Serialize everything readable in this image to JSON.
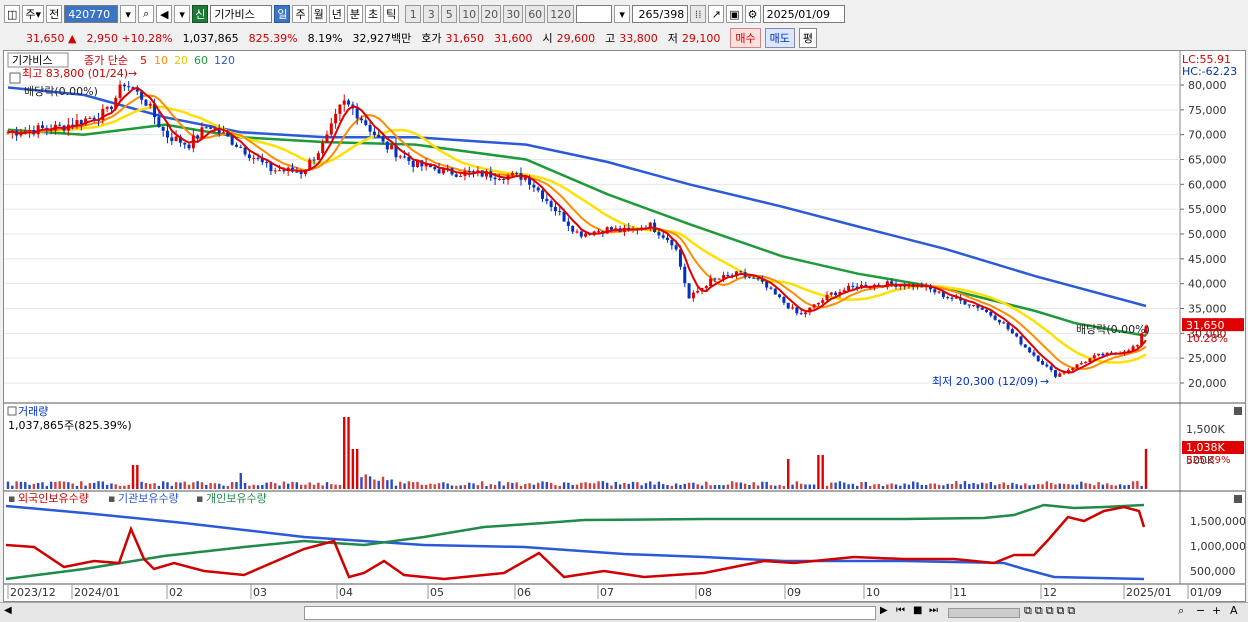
{
  "toolbar": {
    "market": "주",
    "prev": "전",
    "code": "420770",
    "name_badge": "신",
    "name": "기가비스",
    "periods": [
      "일",
      "주",
      "월",
      "년",
      "분",
      "초",
      "틱"
    ],
    "selected_period": "일",
    "intervals": [
      "1",
      "3",
      "5",
      "10",
      "20",
      "30",
      "60",
      "120"
    ],
    "count": "265",
    "total": "/398",
    "date": "2025/01/09"
  },
  "quote": {
    "price": "31,650",
    "change": "2,950",
    "change_pct": "+10.28%",
    "volume": "1,037,865",
    "vol_ratio": "825.39%",
    "turnover": "8.19%",
    "amount": "32,927백만",
    "bid_label": "호가",
    "ask": "31,650",
    "bid": "31,600",
    "open_label": "시",
    "open": "29,600",
    "high_label": "고",
    "high": "33,800",
    "low_label": "저",
    "low": "29,100",
    "buy_label": "매수",
    "sell_label": "매도",
    "avg_label": "평"
  },
  "price_panel": {
    "stock_tag": "기가비스",
    "ma_title": "종가 단순",
    "ma_periods": [
      "5",
      "10",
      "20",
      "60",
      "120"
    ],
    "ma_colors": [
      "#e00000",
      "#ff8c00",
      "#ffe000",
      "#1f9a3a",
      "#2a5ad8"
    ],
    "high_marker": "최고 83,800 (01/24)",
    "low_marker": "최저 20,300 (12/09)",
    "dividend_left": "배당락(0.00%)",
    "dividend_right": "배당락(0.00%)",
    "lc": "LC:55.91",
    "hc": "HC:-62.23",
    "current_price_tag": "31,650",
    "current_pct_tag": "10.28%"
  },
  "volume_panel": {
    "title": "거래량",
    "value": "1,037,865주(825.39%)",
    "tag": "1,038K",
    "tag_pct": "825.39%",
    "axis": [
      "1,500K",
      "1,000K",
      "500K"
    ]
  },
  "holdings_panel": {
    "legends": [
      "외국인보유수량",
      "기관보유수량",
      "개인보유수량"
    ],
    "colors": [
      "#d00000",
      "#2a5ad8",
      "#1f8a4a"
    ],
    "axis": [
      "1,500,000",
      "1,000,000",
      "500,000"
    ]
  },
  "x_axis": [
    "2023/12",
    "2024/01",
    "02",
    "03",
    "04",
    "05",
    "06",
    "07",
    "08",
    "09",
    "10",
    "11",
    "12",
    "2025/01",
    "01/09"
  ],
  "chart_data": {
    "type": "candlestick",
    "ylim": [
      17500,
      86000
    ],
    "y_ticks": [
      "80,000",
      "75,000",
      "70,000",
      "65,000",
      "60,000",
      "55,000",
      "50,000",
      "45,000",
      "40,000",
      "35,000",
      "30,000",
      "25,000",
      "20,000"
    ],
    "close_series": [
      [
        "2023/12/15",
        70500
      ],
      [
        "2024/01/02",
        71500
      ],
      [
        "2024/01/10",
        73000
      ],
      [
        "2024/01/18",
        74500
      ],
      [
        "2024/01/24",
        80500
      ],
      [
        "2024/01/31",
        77000
      ],
      [
        "2024/02/07",
        70000
      ],
      [
        "2024/02/15",
        68000
      ],
      [
        "2024/02/22",
        72000
      ],
      [
        "2024/03/04",
        67500
      ],
      [
        "2024/03/14",
        63000
      ],
      [
        "2024/03/25",
        62500
      ],
      [
        "2024/04/02",
        68500
      ],
      [
        "2024/04/08",
        76500
      ],
      [
        "2024/04/12",
        75000
      ],
      [
        "2024/04/22",
        68000
      ],
      [
        "2024/05/03",
        64000
      ],
      [
        "2024/05/14",
        62500
      ],
      [
        "2024/05/28",
        62000
      ],
      [
        "2024/06/10",
        61500
      ],
      [
        "2024/06/20",
        55000
      ],
      [
        "2024/06/28",
        50000
      ],
      [
        "2024/07/08",
        51000
      ],
      [
        "2024/07/15",
        50500
      ],
      [
        "2024/07/22",
        52000
      ],
      [
        "2024/07/31",
        48000
      ],
      [
        "2024/08/05",
        37000
      ],
      [
        "2024/08/12",
        40500
      ],
      [
        "2024/08/22",
        42000
      ],
      [
        "2024/08/29",
        40500
      ],
      [
        "2024/09/06",
        36500
      ],
      [
        "2024/09/12",
        33500
      ],
      [
        "2024/09/23",
        38000
      ],
      [
        "2024/10/02",
        39500
      ],
      [
        "2024/10/14",
        40000
      ],
      [
        "2024/10/24",
        39500
      ],
      [
        "2024/11/01",
        37500
      ],
      [
        "2024/11/12",
        35500
      ],
      [
        "2024/11/20",
        32500
      ],
      [
        "2024/11/28",
        27500
      ],
      [
        "2024/12/09",
        21500
      ],
      [
        "2024/12/16",
        23500
      ],
      [
        "2024/12/23",
        25500
      ],
      [
        "2024/12/30",
        26000
      ],
      [
        "2025/01/06",
        27500
      ],
      [
        "2025/01/09",
        31650
      ]
    ],
    "ma120": [
      [
        "2023/12/15",
        79500
      ],
      [
        "2024/01/10",
        78000
      ],
      [
        "2024/02/07",
        73500
      ],
      [
        "2024/03/04",
        70500
      ],
      [
        "2024/04/02",
        69500
      ],
      [
        "2024/05/03",
        69500
      ],
      [
        "2024/06/10",
        68000
      ],
      [
        "2024/07/08",
        64500
      ],
      [
        "2024/08/05",
        60000
      ],
      [
        "2024/09/06",
        55500
      ],
      [
        "2024/10/02",
        51500
      ],
      [
        "2024/11/01",
        47000
      ],
      [
        "2024/12/02",
        41500
      ],
      [
        "2025/01/09",
        35500
      ]
    ],
    "ma60": [
      [
        "2023/12/15",
        71000
      ],
      [
        "2024/01/10",
        70000
      ],
      [
        "2024/02/07",
        72000
      ],
      [
        "2024/03/04",
        69500
      ],
      [
        "2024/04/02",
        68500
      ],
      [
        "2024/05/03",
        68000
      ],
      [
        "2024/06/10",
        65000
      ],
      [
        "2024/07/08",
        58000
      ],
      [
        "2024/08/05",
        52000
      ],
      [
        "2024/09/06",
        45500
      ],
      [
        "2024/10/02",
        42000
      ],
      [
        "2024/11/01",
        39000
      ],
      [
        "2024/12/02",
        34500
      ],
      [
        "2024/12/16",
        32000
      ],
      [
        "2025/01/09",
        29500
      ]
    ]
  }
}
